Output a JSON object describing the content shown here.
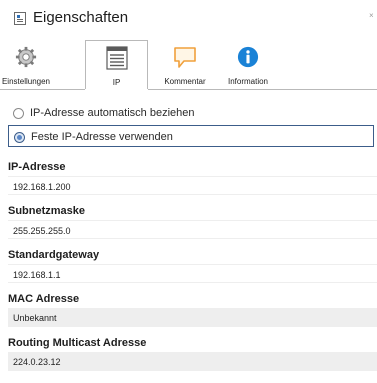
{
  "window": {
    "title": "Eigenschaften",
    "close_glyph": "×"
  },
  "tabs": [
    {
      "label": "Einstellungen",
      "icon": "gear-icon"
    },
    {
      "label": "IP",
      "icon": "ip-list-icon"
    },
    {
      "label": "Kommentar",
      "icon": "comment-icon"
    },
    {
      "label": "Information",
      "icon": "info-icon"
    }
  ],
  "active_tab": "IP",
  "ip_mode": {
    "auto_label": "IP-Adresse automatisch beziehen",
    "fixed_label": "Feste IP-Adresse verwenden",
    "selected": "fixed"
  },
  "fields": {
    "ip_address": {
      "label": "IP-Adresse",
      "value": "192.168.1.200"
    },
    "subnet_mask": {
      "label": "Subnetzmaske",
      "value": "255.255.255.0"
    },
    "gateway": {
      "label": "Standardgateway",
      "value": "192.168.1.1"
    },
    "mac": {
      "label": "MAC Adresse",
      "value": "Unbekannt"
    },
    "multicast": {
      "label": "Routing Multicast Adresse",
      "value": "224.0.23.12"
    }
  },
  "colors": {
    "accent_border": "#3c5d8a",
    "info_blue": "#1a82d6",
    "comment_orange": "#f0a03c",
    "readonly_bg": "#eeeeee"
  }
}
